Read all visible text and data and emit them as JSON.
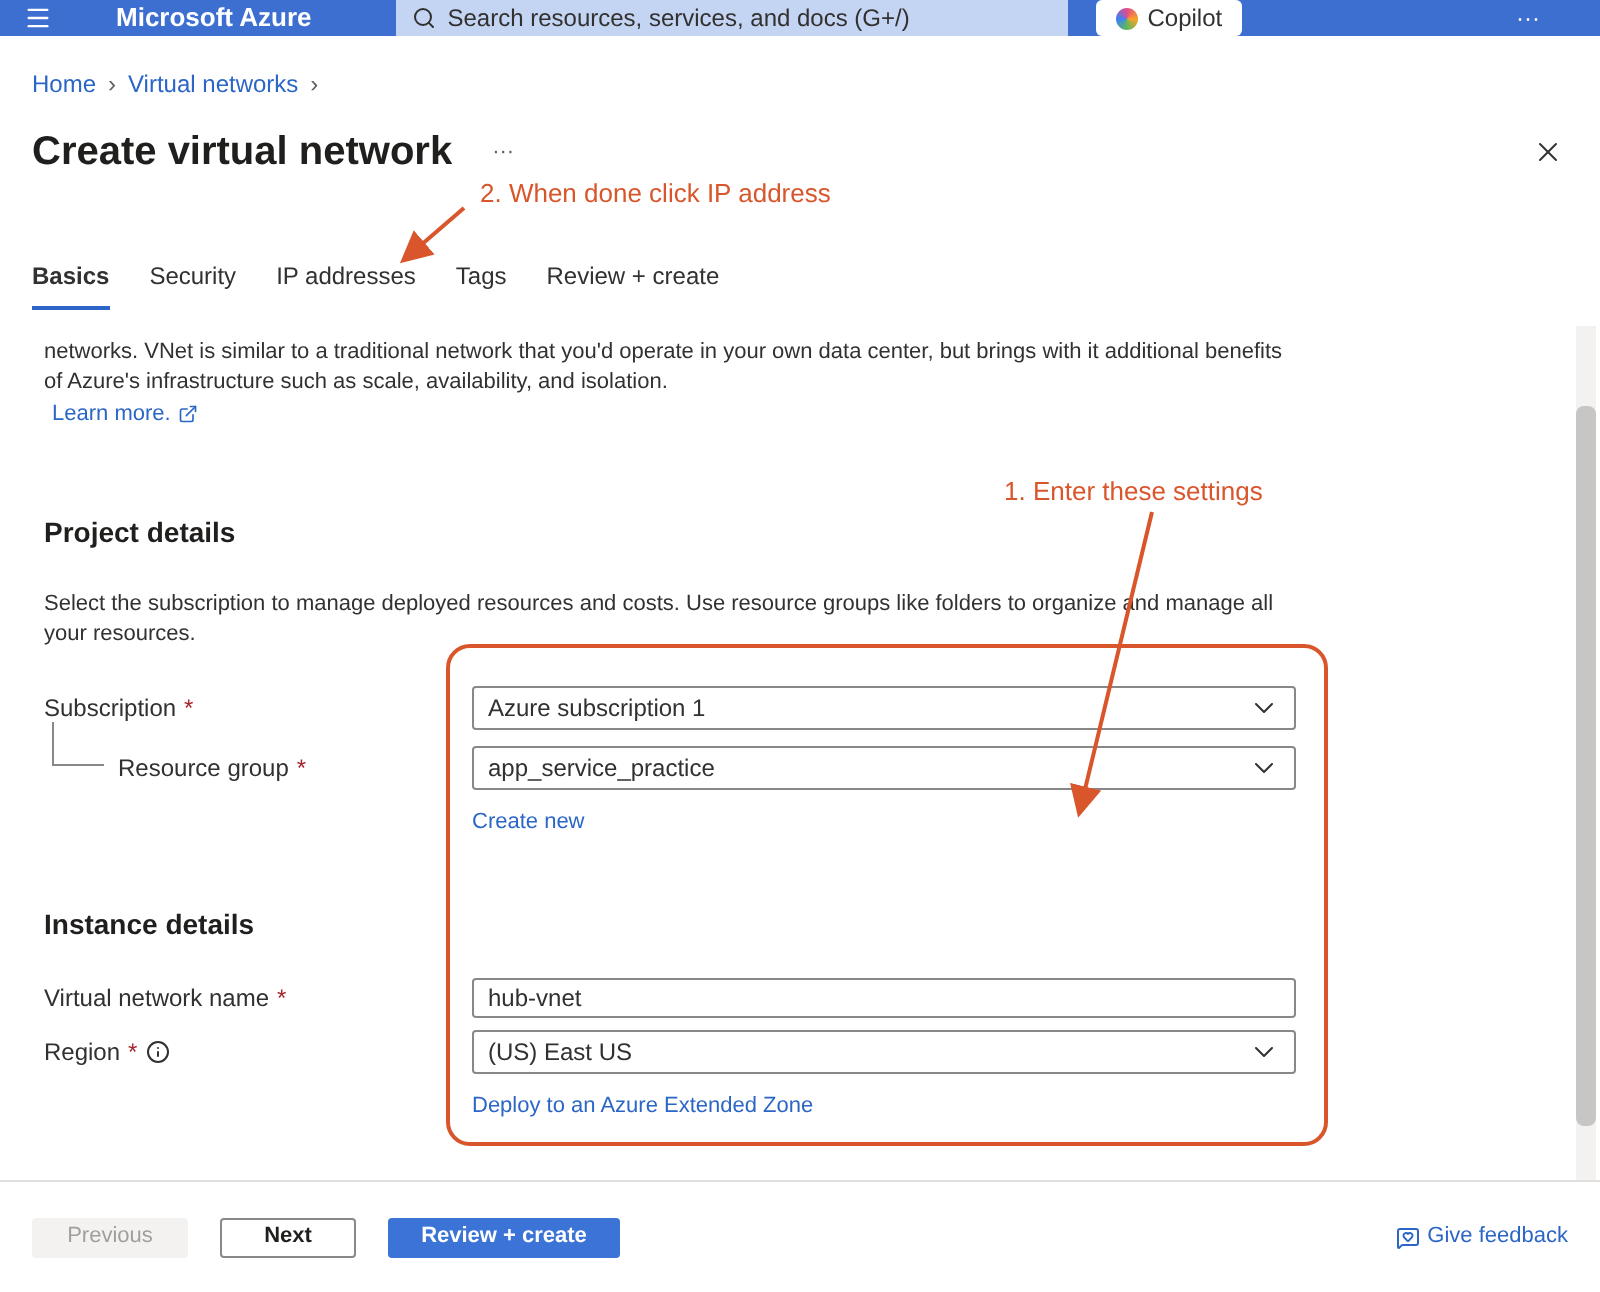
{
  "topbar": {
    "brand": "Microsoft Azure",
    "search_placeholder": "Search resources, services, and docs (G+/)",
    "copilot": "Copilot",
    "more": "···"
  },
  "breadcrumb": [
    "Home",
    "Virtual networks"
  ],
  "breadcrumb_separator": "›",
  "title": "Create virtual network",
  "title_more": "···",
  "tabs": [
    {
      "label": "Basics",
      "selected": true
    },
    {
      "label": "Security",
      "selected": false
    },
    {
      "label": "IP addresses",
      "selected": false
    },
    {
      "label": "Tags",
      "selected": false
    },
    {
      "label": "Review + create",
      "selected": false
    }
  ],
  "intro": "networks. VNet is similar to a traditional network that you'd operate in your own data center, but brings with it additional benefits of Azure's infrastructure such as scale, availability, and isolation.",
  "learn_more": "Learn more.",
  "project": {
    "heading": "Project details",
    "description": "Select the subscription to manage deployed resources and costs. Use resource groups like folders to organize and manage all your resources.",
    "fields": [
      {
        "label": "Subscription",
        "required": "*",
        "kind": "dropdown",
        "value": "Azure subscription 1"
      },
      {
        "label": "Resource group",
        "required": "*",
        "kind": "dropdown",
        "value": "app_service_practice",
        "link": "Create new"
      }
    ]
  },
  "instance": {
    "heading": "Instance details",
    "fields": [
      {
        "label": "Virtual network name",
        "required": "*",
        "kind": "text",
        "value": "hub-vnet"
      },
      {
        "label": "Region",
        "required": "*",
        "info": true,
        "kind": "dropdown",
        "value": "(US) East US",
        "link": "Deploy to an Azure Extended Zone"
      }
    ]
  },
  "annotations": [
    {
      "text": "2. When done click IP address"
    },
    {
      "text": "1. Enter these settings"
    }
  ],
  "footer": {
    "buttons": [
      {
        "label": "Previous",
        "kind": "secondary",
        "disabled": true
      },
      {
        "label": "Next",
        "kind": "secondary",
        "disabled": false
      },
      {
        "label": "Review + create",
        "kind": "primary",
        "disabled": false
      }
    ],
    "feedback": "Give feedback"
  }
}
